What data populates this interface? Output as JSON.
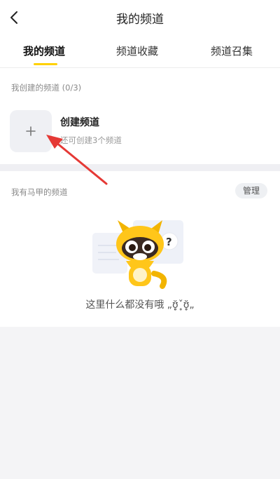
{
  "header": {
    "title": "我的频道",
    "back_icon": "chevron-left-icon"
  },
  "tabs": [
    {
      "label": "我的频道",
      "active": true
    },
    {
      "label": "频道收藏",
      "active": false
    },
    {
      "label": "频道召集",
      "active": false
    }
  ],
  "created": {
    "section_label": "我创建的频道 (0/3)",
    "create_title": "创建频道",
    "create_subtitle": "还可创建3个频道",
    "plus_icon": "plus-icon"
  },
  "alt": {
    "section_label": "我有马甲的频道",
    "manage_label": "管理",
    "empty_text": "这里什么都没有哦 „ʊ̥̥̥̆ˇ̥ʊ̥̥̆„",
    "illustration": "raccoon-question-illustration"
  },
  "colors": {
    "accent": "#ffd100",
    "arrow": "#e53935"
  }
}
